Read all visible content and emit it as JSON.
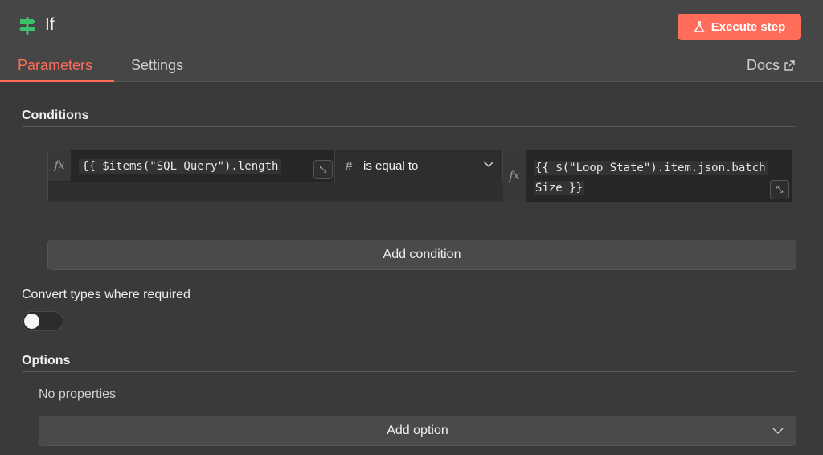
{
  "node": {
    "title": "If",
    "icon": "signpost-icon"
  },
  "header": {
    "execute_label": "Execute step",
    "execute_icon": "flask-icon",
    "accent": "#ff6d5a"
  },
  "tabs": [
    {
      "label": "Parameters",
      "active": true
    },
    {
      "label": "Settings",
      "active": false
    }
  ],
  "docs": {
    "label": "Docs",
    "icon": "external-link-icon"
  },
  "conditions": {
    "title": "Conditions",
    "left_expression": "{{ $items(\"SQL Query\").length",
    "operator": {
      "type_icon": "#",
      "label": "is equal to"
    },
    "right_expression_line1": "{{ $(\"Loop State\").item.json.batch",
    "right_expression_line2": "Size }}",
    "fx_label": "fx",
    "add_label": "Add condition"
  },
  "convert": {
    "label": "Convert types where required",
    "enabled": false
  },
  "options": {
    "title": "Options",
    "empty_text": "No properties",
    "add_label": "Add option"
  }
}
